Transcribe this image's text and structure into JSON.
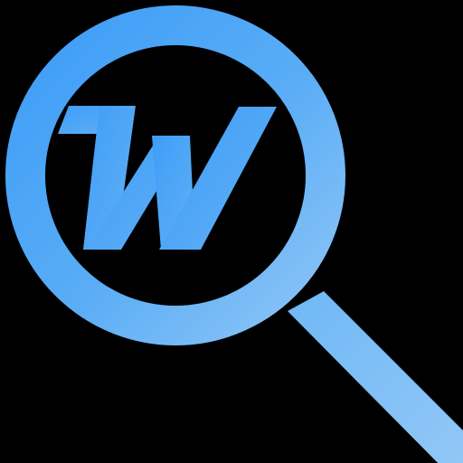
{
  "icon": {
    "name": "magnifier-w-icon",
    "logo_letter": "W",
    "colors": {
      "background": "#000000",
      "accent_light": "#8EC5F6",
      "accent": "#5AADF6",
      "accent_dark": "#3E9DF7"
    }
  }
}
